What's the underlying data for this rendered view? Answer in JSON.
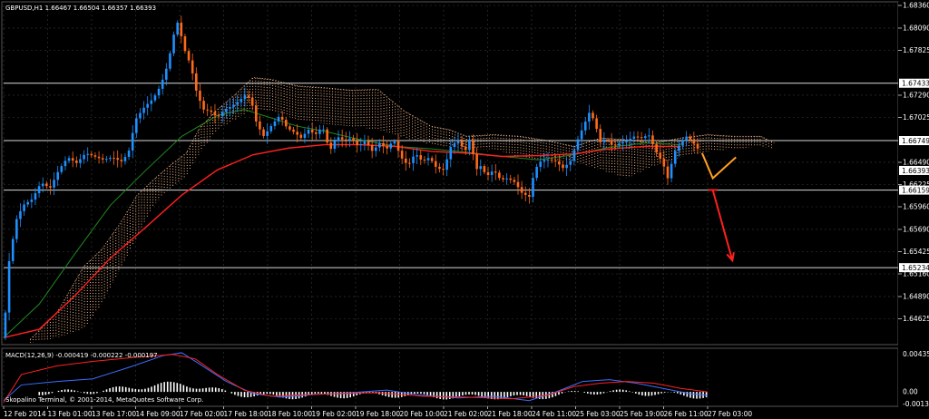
{
  "window": {
    "header": "GBPUSD,H1  1.66467 1.66504 1.66357 1.66393"
  },
  "colors": {
    "background": "#000000",
    "grid": "#3a3a3a",
    "bull": "#1e90ff",
    "bear": "#ff6a1a",
    "ma_fast": "#ff2020",
    "ma_slow": "#1f8a1f",
    "cloud": "#f2b48a",
    "projection": "#ffa020",
    "arrow": "#ff2020",
    "macd_signal": "#ff2020",
    "macd_line": "#3b6fff",
    "hist": "#ffffff"
  },
  "chart_data": {
    "type": "candlestick",
    "symbol": "GBPUSD,H1",
    "ohlc_readout": {
      "open": 1.66467,
      "high": 1.66504,
      "low": 1.66357,
      "close": 1.66393
    },
    "ylim": [
      1.6436,
      1.6836
    ],
    "y_ticks": [
      "1.68360",
      "1.68090",
      "1.67825",
      "1.67290",
      "1.67025",
      "1.66490",
      "1.66225",
      "1.65960",
      "1.65690",
      "1.65425",
      "1.65160",
      "1.64890",
      "1.64625"
    ],
    "x_ticks": [
      "12 Feb 2014",
      "13 Feb 01:00",
      "13 Feb 17:00",
      "14 Feb 09:00",
      "17 Feb 02:00",
      "17 Feb 18:00",
      "18 Feb 10:00",
      "19 Feb 02:00",
      "19 Feb 18:00",
      "20 Feb 10:00",
      "21 Feb 02:00",
      "21 Feb 18:00",
      "24 Feb 11:00",
      "25 Feb 03:00",
      "25 Feb 19:00",
      "26 Feb 11:00",
      "27 Feb 03:00"
    ],
    "horizontal_levels": [
      {
        "price": 1.67433,
        "label": "1.67433"
      },
      {
        "price": 1.66749,
        "label": "1.66749"
      },
      {
        "price": 1.66159,
        "label": "1.66159"
      },
      {
        "price": 1.65234,
        "label": "1.65234"
      }
    ],
    "current_price": {
      "price": 1.66393,
      "label": "1.66393"
    },
    "price_path": [
      [
        0,
        1.644
      ],
      [
        6,
        1.653
      ],
      [
        14,
        1.658
      ],
      [
        22,
        1.6598
      ],
      [
        32,
        1.6605
      ],
      [
        42,
        1.6625
      ],
      [
        52,
        1.6618
      ],
      [
        62,
        1.664
      ],
      [
        72,
        1.6655
      ],
      [
        82,
        1.6648
      ],
      [
        92,
        1.666
      ],
      [
        102,
        1.6656
      ],
      [
        112,
        1.6652
      ],
      [
        122,
        1.6655
      ],
      [
        132,
        1.665
      ],
      [
        140,
        1.666
      ],
      [
        148,
        1.67
      ],
      [
        158,
        1.6715
      ],
      [
        168,
        1.6725
      ],
      [
        176,
        1.674
      ],
      [
        184,
        1.6765
      ],
      [
        190,
        1.6795
      ],
      [
        194,
        1.682
      ],
      [
        198,
        1.6805
      ],
      [
        204,
        1.678
      ],
      [
        210,
        1.6765
      ],
      [
        216,
        1.6735
      ],
      [
        224,
        1.6712
      ],
      [
        232,
        1.671
      ],
      [
        240,
        1.6702
      ],
      [
        248,
        1.6712
      ],
      [
        256,
        1.6716
      ],
      [
        264,
        1.6722
      ],
      [
        272,
        1.673
      ],
      [
        278,
        1.6722
      ],
      [
        284,
        1.6695
      ],
      [
        292,
        1.668
      ],
      [
        300,
        1.6692
      ],
      [
        310,
        1.6705
      ],
      [
        318,
        1.669
      ],
      [
        326,
        1.6685
      ],
      [
        334,
        1.6678
      ],
      [
        342,
        1.6688
      ],
      [
        350,
        1.6682
      ],
      [
        358,
        1.6692
      ],
      [
        366,
        1.6662
      ],
      [
        374,
        1.668
      ],
      [
        382,
        1.6675
      ],
      [
        390,
        1.6678
      ],
      [
        398,
        1.6668
      ],
      [
        406,
        1.6675
      ],
      [
        414,
        1.6662
      ],
      [
        422,
        1.6672
      ],
      [
        430,
        1.6665
      ],
      [
        438,
        1.6676
      ],
      [
        446,
        1.6655
      ],
      [
        454,
        1.6645
      ],
      [
        462,
        1.666
      ],
      [
        470,
        1.665
      ],
      [
        478,
        1.6655
      ],
      [
        486,
        1.6642
      ],
      [
        494,
        1.664
      ],
      [
        502,
        1.6668
      ],
      [
        510,
        1.6675
      ],
      [
        518,
        1.6662
      ],
      [
        524,
        1.6678
      ],
      [
        530,
        1.664
      ],
      [
        536,
        1.6645
      ],
      [
        542,
        1.6632
      ],
      [
        550,
        1.664
      ],
      [
        558,
        1.6628
      ],
      [
        566,
        1.663
      ],
      [
        574,
        1.6625
      ],
      [
        582,
        1.6612
      ],
      [
        590,
        1.6608
      ],
      [
        596,
        1.664
      ],
      [
        604,
        1.6652
      ],
      [
        612,
        1.6652
      ],
      [
        620,
        1.665
      ],
      [
        628,
        1.6642
      ],
      [
        636,
        1.665
      ],
      [
        644,
        1.6675
      ],
      [
        652,
        1.6695
      ],
      [
        658,
        1.671
      ],
      [
        664,
        1.6695
      ],
      [
        670,
        1.6672
      ],
      [
        676,
        1.6678
      ],
      [
        684,
        1.6668
      ],
      [
        692,
        1.6672
      ],
      [
        700,
        1.6675
      ],
      [
        708,
        1.668
      ],
      [
        716,
        1.6678
      ],
      [
        724,
        1.6682
      ],
      [
        732,
        1.6662
      ],
      [
        740,
        1.6648
      ],
      [
        746,
        1.6628
      ],
      [
        752,
        1.666
      ],
      [
        760,
        1.6672
      ],
      [
        766,
        1.668
      ],
      [
        772,
        1.6675
      ],
      [
        780,
        1.6664
      ]
    ],
    "ma_fast": [
      [
        0,
        1.644
      ],
      [
        40,
        1.645
      ],
      [
        80,
        1.649
      ],
      [
        120,
        1.6535
      ],
      [
        160,
        1.6572
      ],
      [
        200,
        1.661
      ],
      [
        240,
        1.664
      ],
      [
        280,
        1.6658
      ],
      [
        320,
        1.6666
      ],
      [
        360,
        1.667
      ],
      [
        400,
        1.667
      ],
      [
        440,
        1.6668
      ],
      [
        480,
        1.6662
      ],
      [
        520,
        1.666
      ],
      [
        560,
        1.6656
      ],
      [
        600,
        1.6657
      ],
      [
        640,
        1.6659
      ],
      [
        680,
        1.6665
      ],
      [
        720,
        1.6668
      ],
      [
        760,
        1.6668
      ]
    ],
    "ma_slow": [
      [
        0,
        1.644
      ],
      [
        40,
        1.648
      ],
      [
        80,
        1.654
      ],
      [
        120,
        1.6598
      ],
      [
        160,
        1.664
      ],
      [
        200,
        1.668
      ],
      [
        240,
        1.6705
      ],
      [
        270,
        1.6712
      ],
      [
        300,
        1.6702
      ],
      [
        330,
        1.6692
      ],
      [
        360,
        1.6686
      ],
      [
        400,
        1.6676
      ],
      [
        440,
        1.6668
      ],
      [
        480,
        1.6665
      ],
      [
        520,
        1.6661
      ],
      [
        560,
        1.6656
      ],
      [
        600,
        1.6652
      ],
      [
        640,
        1.6658
      ],
      [
        680,
        1.6667
      ],
      [
        720,
        1.6672
      ],
      [
        760,
        1.667
      ]
    ],
    "cloud": {
      "upper": [
        [
          30,
          1.6438
        ],
        [
          60,
          1.647
        ],
        [
          90,
          1.6525
        ],
        [
          110,
          1.6545
        ],
        [
          130,
          1.6575
        ],
        [
          150,
          1.661
        ],
        [
          170,
          1.663
        ],
        [
          190,
          1.6648
        ],
        [
          205,
          1.666
        ],
        [
          220,
          1.669
        ],
        [
          240,
          1.6712
        ],
        [
          260,
          1.673
        ],
        [
          280,
          1.675
        ],
        [
          300,
          1.6748
        ],
        [
          330,
          1.674
        ],
        [
          360,
          1.6738
        ],
        [
          390,
          1.6735
        ],
        [
          420,
          1.6736
        ],
        [
          450,
          1.671
        ],
        [
          480,
          1.6692
        ],
        [
          500,
          1.6688
        ],
        [
          520,
          1.668
        ],
        [
          550,
          1.6682
        ],
        [
          580,
          1.668
        ],
        [
          610,
          1.6675
        ],
        [
          640,
          1.6668
        ],
        [
          670,
          1.6678
        ],
        [
          700,
          1.6676
        ],
        [
          730,
          1.6672
        ],
        [
          760,
          1.6678
        ],
        [
          790,
          1.6682
        ],
        [
          820,
          1.668
        ],
        [
          850,
          1.668
        ],
        [
          865,
          1.6672
        ]
      ],
      "lower": [
        [
          30,
          1.6434
        ],
        [
          60,
          1.644
        ],
        [
          90,
          1.645
        ],
        [
          110,
          1.648
        ],
        [
          130,
          1.652
        ],
        [
          150,
          1.656
        ],
        [
          170,
          1.66
        ],
        [
          190,
          1.662
        ],
        [
          205,
          1.6632
        ],
        [
          220,
          1.666
        ],
        [
          240,
          1.6688
        ],
        [
          260,
          1.67
        ],
        [
          280,
          1.6712
        ],
        [
          300,
          1.671
        ],
        [
          330,
          1.67
        ],
        [
          360,
          1.6695
        ],
        [
          390,
          1.6692
        ],
        [
          420,
          1.6688
        ],
        [
          450,
          1.6678
        ],
        [
          480,
          1.667
        ],
        [
          500,
          1.6668
        ],
        [
          520,
          1.6664
        ],
        [
          550,
          1.6665
        ],
        [
          580,
          1.6655
        ],
        [
          610,
          1.6652
        ],
        [
          640,
          1.665
        ],
        [
          670,
          1.664
        ],
        [
          700,
          1.663
        ],
        [
          730,
          1.6645
        ],
        [
          760,
          1.6655
        ],
        [
          790,
          1.6662
        ],
        [
          820,
          1.6665
        ],
        [
          850,
          1.6668
        ],
        [
          865,
          1.6665
        ]
      ]
    },
    "projection": [
      [
        784,
        1.666
      ],
      [
        796,
        1.663
      ],
      [
        822,
        1.6655
      ]
    ],
    "arrow": {
      "from": [
        796,
        1.6616
      ],
      "to": [
        818,
        1.6532
      ]
    },
    "macd": {
      "label": "MACD(12,26,9) -0.000419 -0.000222 -0.000197",
      "y_ticks": [
        "0.004351",
        "0.00",
        "-0.001381"
      ],
      "ylim": [
        -0.00145,
        0.0046
      ],
      "signal": [
        [
          0,
          -0.0012
        ],
        [
          20,
          0.002
        ],
        [
          60,
          0.003
        ],
        [
          100,
          0.0035
        ],
        [
          150,
          0.004
        ],
        [
          190,
          0.0043
        ],
        [
          215,
          0.0038
        ],
        [
          240,
          0.002
        ],
        [
          270,
          0.0002
        ],
        [
          300,
          -0.0005
        ],
        [
          340,
          -0.0003
        ],
        [
          380,
          -0.0002
        ],
        [
          420,
          -0.0001
        ],
        [
          470,
          -0.0005
        ],
        [
          520,
          -0.0006
        ],
        [
          570,
          -0.0008
        ],
        [
          610,
          -0.0004
        ],
        [
          640,
          0.0006
        ],
        [
          670,
          0.001
        ],
        [
          700,
          0.0012
        ],
        [
          730,
          0.001
        ],
        [
          760,
          0.0004
        ],
        [
          790,
          0.0
        ]
      ],
      "line": [
        [
          0,
          -0.001
        ],
        [
          20,
          0.0008
        ],
        [
          60,
          0.0012
        ],
        [
          100,
          0.0015
        ],
        [
          140,
          0.0028
        ],
        [
          180,
          0.0042
        ],
        [
          200,
          0.0045
        ],
        [
          220,
          0.0032
        ],
        [
          250,
          0.0012
        ],
        [
          280,
          -0.0002
        ],
        [
          310,
          -0.0006
        ],
        [
          350,
          -0.0003
        ],
        [
          390,
          -0.0001
        ],
        [
          430,
          0.0002
        ],
        [
          470,
          -0.0004
        ],
        [
          510,
          -0.0007
        ],
        [
          550,
          -0.0005
        ],
        [
          590,
          -0.001
        ],
        [
          620,
          0.0
        ],
        [
          650,
          0.0012
        ],
        [
          680,
          0.0014
        ],
        [
          710,
          0.001
        ],
        [
          740,
          0.0004
        ],
        [
          770,
          -0.0002
        ],
        [
          790,
          -0.0004
        ]
      ]
    }
  },
  "footer": {
    "copyright": "Skopalino Terminal, © 2001-2014, MetaQuotes Software Corp."
  }
}
